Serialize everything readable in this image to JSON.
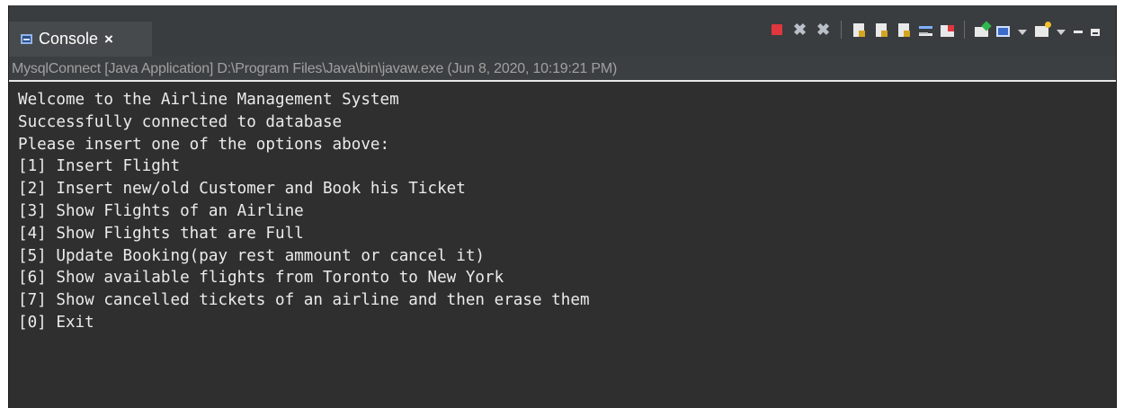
{
  "tab": {
    "title": "Console",
    "close_glyph": "×",
    "icon": "console-icon"
  },
  "toolbar": {
    "icons": [
      "terminate-icon",
      "remove-launch-icon",
      "remove-all-terminated-icon",
      "clear-console-icon",
      "scroll-lock-icon",
      "word-wrap-icon",
      "show-on-stdout-icon",
      "show-on-stderr-icon",
      "pin-console-icon",
      "display-selected-console-icon",
      "open-console-icon",
      "minimize-icon",
      "maximize-icon"
    ]
  },
  "header": {
    "text": "MysqlConnect [Java Application] D:\\Program Files\\Java\\bin\\javaw.exe (Jun 8, 2020, 10:19:21 PM)"
  },
  "console": {
    "lines": [
      "Welcome to the Airline Management System",
      "Successfully connected to database",
      "Please insert one of the options above:",
      "[1] Insert Flight",
      "[2] Insert new/old Customer and Book his Ticket",
      "[3] Show Flights of an Airline",
      "[4] Show Flights that are Full",
      "[5] Update Booking(pay rest ammount or cancel it)",
      "[6] Show available flights from Toronto to New York",
      "[7] Show cancelled tickets of an airline and then erase them",
      "[0] Exit"
    ]
  },
  "colors": {
    "panel_bg": "#2f2f2f",
    "tab_bg": "#474a4c",
    "text": "#ebebeb",
    "header_text": "#a0a0a0",
    "terminate_red": "#e0363d"
  }
}
